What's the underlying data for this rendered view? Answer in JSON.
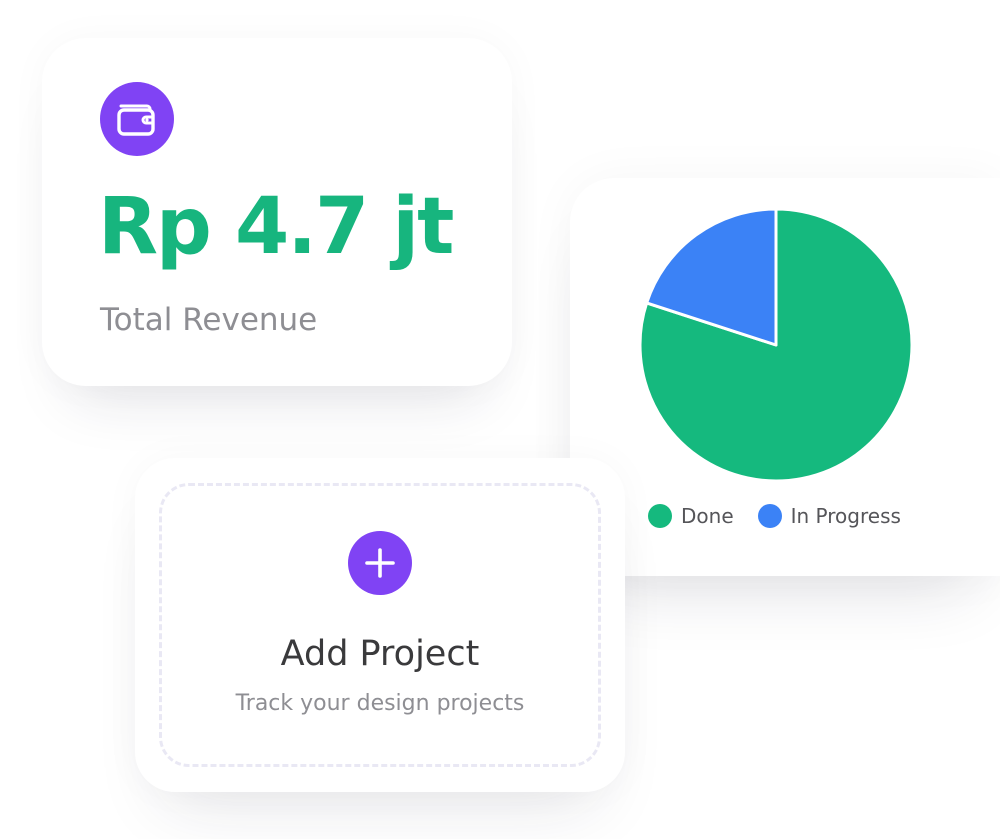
{
  "revenue": {
    "value": "Rp 4.7 jt",
    "label": "Total Revenue",
    "icon": "wallet-icon"
  },
  "add_project": {
    "title": "Add Project",
    "subtitle": "Track your design projects",
    "icon": "plus-icon"
  },
  "colors": {
    "accent_purple": "#8043f4",
    "revenue_green": "#17b57e",
    "done_green": "#15b97e",
    "in_progress_blue": "#3b82f6"
  },
  "chart_data": {
    "type": "pie",
    "title": "",
    "legend_position": "bottom",
    "slices": [
      {
        "label": "Done",
        "value": 80,
        "color": "#15b97e"
      },
      {
        "label": "In Progress",
        "value": 20,
        "color": "#3b82f6"
      }
    ]
  }
}
